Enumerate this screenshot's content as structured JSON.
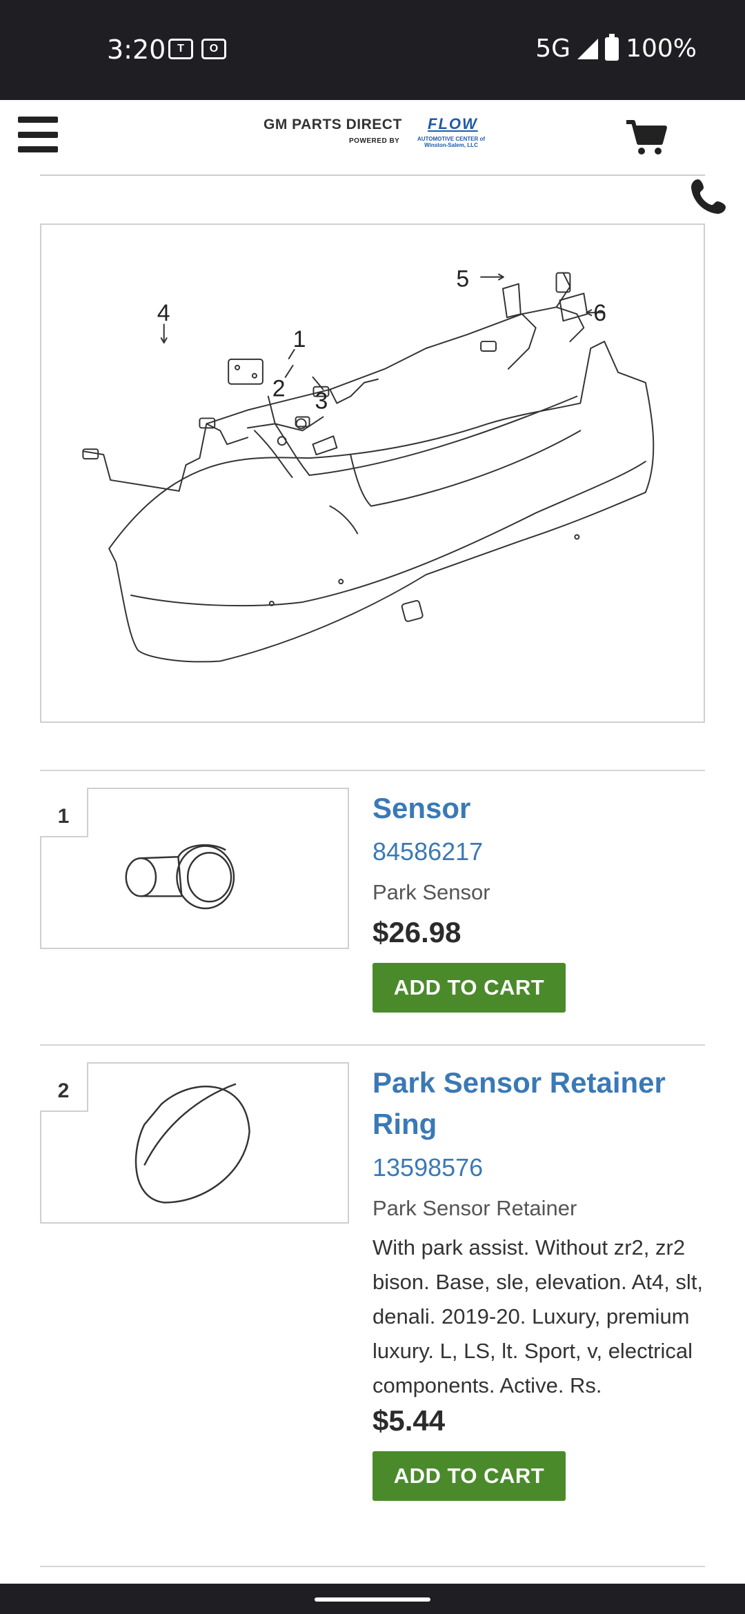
{
  "status_bar": {
    "time": "3:20",
    "network": "5G",
    "battery": "100%",
    "icons": [
      "teams-icon",
      "outlook-icon",
      "signal-icon",
      "battery-icon"
    ]
  },
  "header": {
    "logo_main": "GM PARTS DIRECT",
    "logo_powered": "POWERED BY",
    "logo_flow": "FLOW",
    "logo_flow_sub": "AUTOMOTIVE CENTER of Winston-Salem, LLC",
    "icons": [
      "hamburger-menu-icon",
      "cart-icon",
      "phone-icon"
    ]
  },
  "diagram": {
    "callouts": [
      "1",
      "2",
      "3",
      "4",
      "5",
      "6"
    ]
  },
  "parts": [
    {
      "index": "1",
      "name": "Sensor",
      "number": "84586217",
      "description": "Park Sensor",
      "notes": "",
      "price": "$26.98",
      "button": "ADD TO CART"
    },
    {
      "index": "2",
      "name": "Park Sensor Retainer Ring",
      "number": "13598576",
      "description": "Park Sensor Retainer",
      "notes": "With park assist. Without zr2, zr2 bison. Base, sle, elevation. At4, slt, denali. 2019-20. Luxury, premium luxury. L, LS, lt. Sport, v, electrical components. Active. Rs.",
      "price": "$5.44",
      "button": "ADD TO CART"
    }
  ],
  "colors": {
    "status_bar": "#1f1f23",
    "link_blue": "#3a79b5",
    "button_green": "#4b8a2b"
  }
}
